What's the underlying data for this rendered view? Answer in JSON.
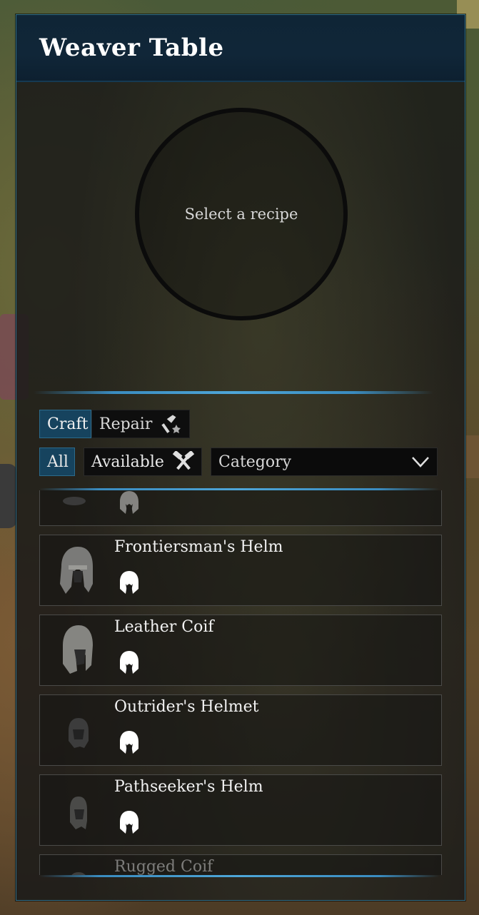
{
  "window": {
    "title": "Weaver Table"
  },
  "preview": {
    "placeholder": "Select a recipe"
  },
  "mode_tabs": [
    {
      "label": "Craft",
      "active": true
    },
    {
      "label": "Repair",
      "active": false,
      "icon": "repair-hammer-icon"
    }
  ],
  "filters": {
    "all_label": "All",
    "available_label": "Available",
    "available_icon": "crossed-hammers-icon",
    "category_label": "Category",
    "category_icon": "chevron-down-icon"
  },
  "recipes": [
    {
      "name": "",
      "icon": "helmet-slot-icon",
      "partial": "top"
    },
    {
      "name": "Frontiersman's Helm",
      "icon": "helmet-slot-icon"
    },
    {
      "name": "Leather Coif",
      "icon": "helmet-slot-icon"
    },
    {
      "name": "Outrider's Helmet",
      "icon": "helmet-slot-icon"
    },
    {
      "name": "Pathseeker's Helm",
      "icon": "helmet-slot-icon"
    },
    {
      "name": "Rugged Coif",
      "icon": "helmet-slot-icon",
      "partial": "bottom"
    }
  ],
  "colors": {
    "accent": "#2b6b8c",
    "header_bg": "#0f2536",
    "active_tab": "#16435e"
  }
}
